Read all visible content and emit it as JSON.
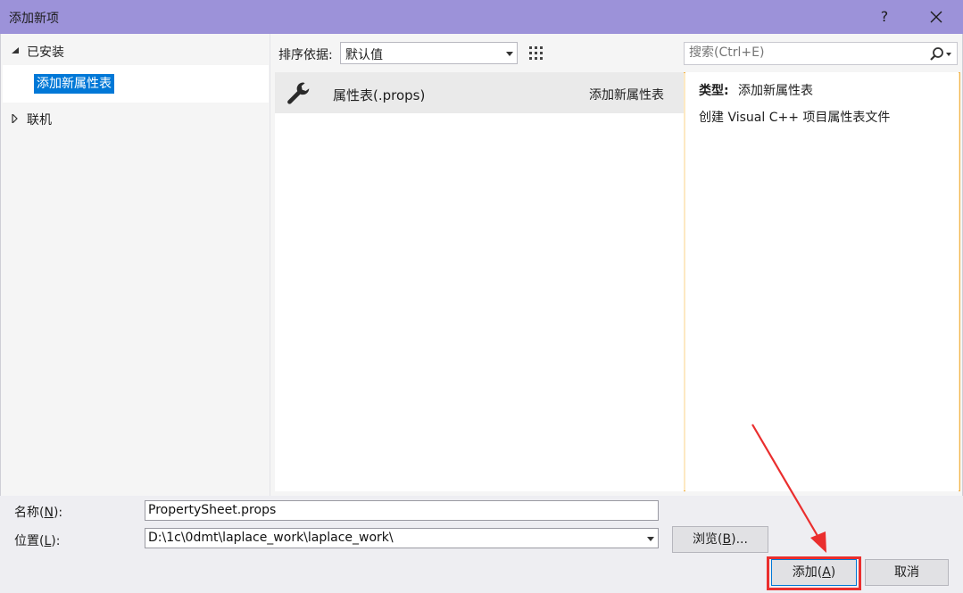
{
  "window": {
    "title": "添加新项",
    "help_label": "?"
  },
  "tree": {
    "installed_label": "已安装",
    "selected_child_label": "添加新属性表",
    "online_label": "联机"
  },
  "toolbar": {
    "sort_label": "排序依据:",
    "sort_value": "默认值"
  },
  "search": {
    "placeholder": "搜索(Ctrl+E)"
  },
  "items": [
    {
      "name": "属性表(.props)",
      "category": "添加新属性表",
      "icon": "wrench-icon"
    }
  ],
  "details": {
    "type_label": "类型:",
    "type_value": "添加新属性表",
    "description": "创建 Visual C++ 项目属性表文件"
  },
  "form": {
    "name_label_pre": "名称(",
    "name_label_key": "N",
    "name_label_post": "):",
    "name_value": "PropertySheet.props",
    "location_label_pre": "位置(",
    "location_label_key": "L",
    "location_label_post": "):",
    "location_value": "D:\\1c\\0dmt\\laplace_work\\laplace_work\\",
    "browse_pre": "浏览(",
    "browse_key": "B",
    "browse_post": ")...",
    "add_pre": "添加(",
    "add_key": "A",
    "add_post": ")",
    "cancel_label": "取消"
  },
  "colors": {
    "titlebar": "#9c92d9",
    "selection": "#0078d7",
    "annotation": "#ea2e2e"
  }
}
